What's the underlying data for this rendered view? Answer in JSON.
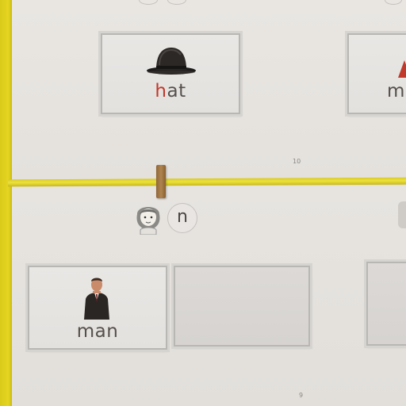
{
  "scene": {
    "cards": {
      "hat_label_initial": "h",
      "hat_label_rest": "at",
      "partial_label": "m",
      "man_label": "man"
    },
    "letter_prompt": "n",
    "page_numbers": {
      "top": "10",
      "bottom": "9"
    },
    "icons": {
      "hat": "bowler-hat-icon",
      "man": "man-in-suit-icon",
      "girl": "girl-face-icon"
    },
    "colors": {
      "yellow": "#e6d622",
      "red_letter": "#c0392b",
      "text": "#55504c"
    }
  }
}
